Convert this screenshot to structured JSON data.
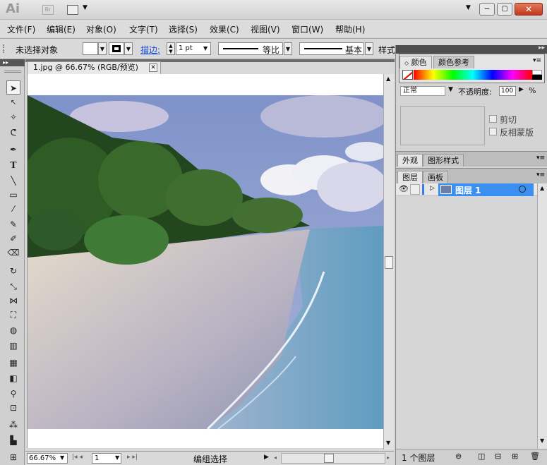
{
  "titlebar": {
    "app_logo": "Ai",
    "br_label": "Br"
  },
  "menu": [
    "文件(F)",
    "编辑(E)",
    "对象(O)",
    "文字(T)",
    "选择(S)",
    "效果(C)",
    "视图(V)",
    "窗口(W)",
    "帮助(H)"
  ],
  "control": {
    "selection": "未选择对象",
    "stroke_label": "描边:",
    "stroke_value": "1 pt",
    "profile1": "等比",
    "profile2": "基本",
    "style_label": "样式:"
  },
  "document": {
    "tab_title": "1.jpg @ 66.67% (RGB/预览)"
  },
  "status": {
    "zoom": "66.67%",
    "page": "1",
    "mode": "编组选择"
  },
  "color_panel": {
    "tab1": "颜色",
    "tab2": "颜色参考",
    "blend_mode": "正常",
    "opacity_label": "不透明度:",
    "opacity_value": "100",
    "opacity_unit": "%",
    "clip_label": "剪切",
    "invert_label": "反相蒙版"
  },
  "appearance": {
    "tab1": "外观",
    "tab2": "图形样式"
  },
  "layers": {
    "tab1": "图层",
    "tab2": "画板",
    "layer_name": "图层 1",
    "count": "1 个图层"
  }
}
